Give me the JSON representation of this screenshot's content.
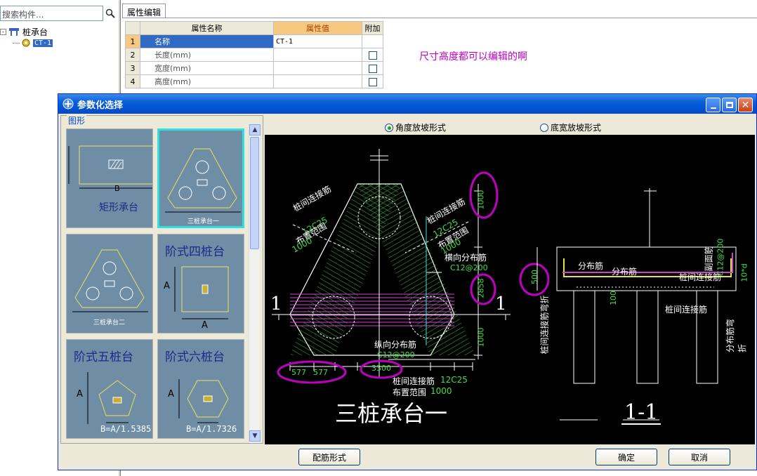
{
  "sidebar": {
    "search_placeholder": "搜索构件...",
    "tree_root": "桩承台",
    "tree_child": "CT-1"
  },
  "property_panel": {
    "tab": "属性编辑",
    "headers": [
      "属性名称",
      "属性值",
      "附加"
    ],
    "rows": [
      {
        "no": "1",
        "name": "名称",
        "value": "CT-1"
      },
      {
        "no": "2",
        "name": "长度(mm)",
        "value": ""
      },
      {
        "no": "3",
        "name": "宽度(mm)",
        "value": ""
      },
      {
        "no": "4",
        "name": "高度(mm)",
        "value": ""
      }
    ],
    "note": "尺寸高度都可以编辑的啊"
  },
  "dialog": {
    "title": "参数化选择",
    "group_label": "图形",
    "radio_angle": "角度放坡形式",
    "radio_width": "底宽放坡形式",
    "btn_rebar": "配筋形式",
    "btn_ok": "确定",
    "btn_cancel": "取消",
    "thumbs": {
      "rect_label": "矩形承台",
      "rect_dim": "B",
      "tri1_label": "三桩承台一",
      "tri2_label": "三桩承台二",
      "four_title": "阶式四桩台",
      "five_title": "阶式五桩台",
      "six_title": "阶式六桩台",
      "five_formula": "B=A/1.5385",
      "six_formula": "B=A/1.7326",
      "dim_a": "A"
    }
  },
  "drawing": {
    "title_main": "三桩承台一",
    "title_section": "1-1",
    "mark_1": "1",
    "lbl_pile_bar_left": "桩间连接筋",
    "lbl_12c25_left": "12C25",
    "lbl_range_left": "布置范围",
    "lbl_1000_left": "1000",
    "lbl_pile_bar_right": "桩间连接筋",
    "lbl_12c25_right": "12C25",
    "lbl_range_right": "布置范围",
    "lbl_1000_right": "1000",
    "lbl_hz_dist": "横向分布筋",
    "lbl_c12_200_a": "C12@200",
    "lbl_long_dist": "纵向分布筋",
    "lbl_c12_200_b": "C12@200",
    "lbl_pile_bar_bottom": "桩间连接筋",
    "lbl_12c25_bottom": "12C25",
    "lbl_range_bottom": "布置范围",
    "lbl_1000_bottom": "1000",
    "dim_1000_top": "1000",
    "dim_2858": "2858",
    "dim_1000_bot": "1000",
    "dim_577a": "577",
    "dim_577b": "577",
    "dim_3300": "3300",
    "sec_dist1": "分布筋",
    "sec_dist2": "分布筋",
    "sec_pile_bar": "桩间连接筋",
    "sec_pile_bar2": "桩间连接筋",
    "sec_top_bar": "副面筋",
    "sec_c12_200": "C12@200",
    "sec_500": "500",
    "sec_100": "100",
    "sec_10d": "10*d",
    "sec_left_vert": "桩间连接筋弯折",
    "sec_right_vert": "分布筋弯折"
  },
  "colors": {
    "accent_magenta": "#c000c0",
    "rebar_green": "#40e040",
    "hatch_magenta": "#d040d0",
    "outline_white": "#ffffff",
    "thumb_bg": "#6f8ea6",
    "thumb_yellow": "#e8e060"
  }
}
